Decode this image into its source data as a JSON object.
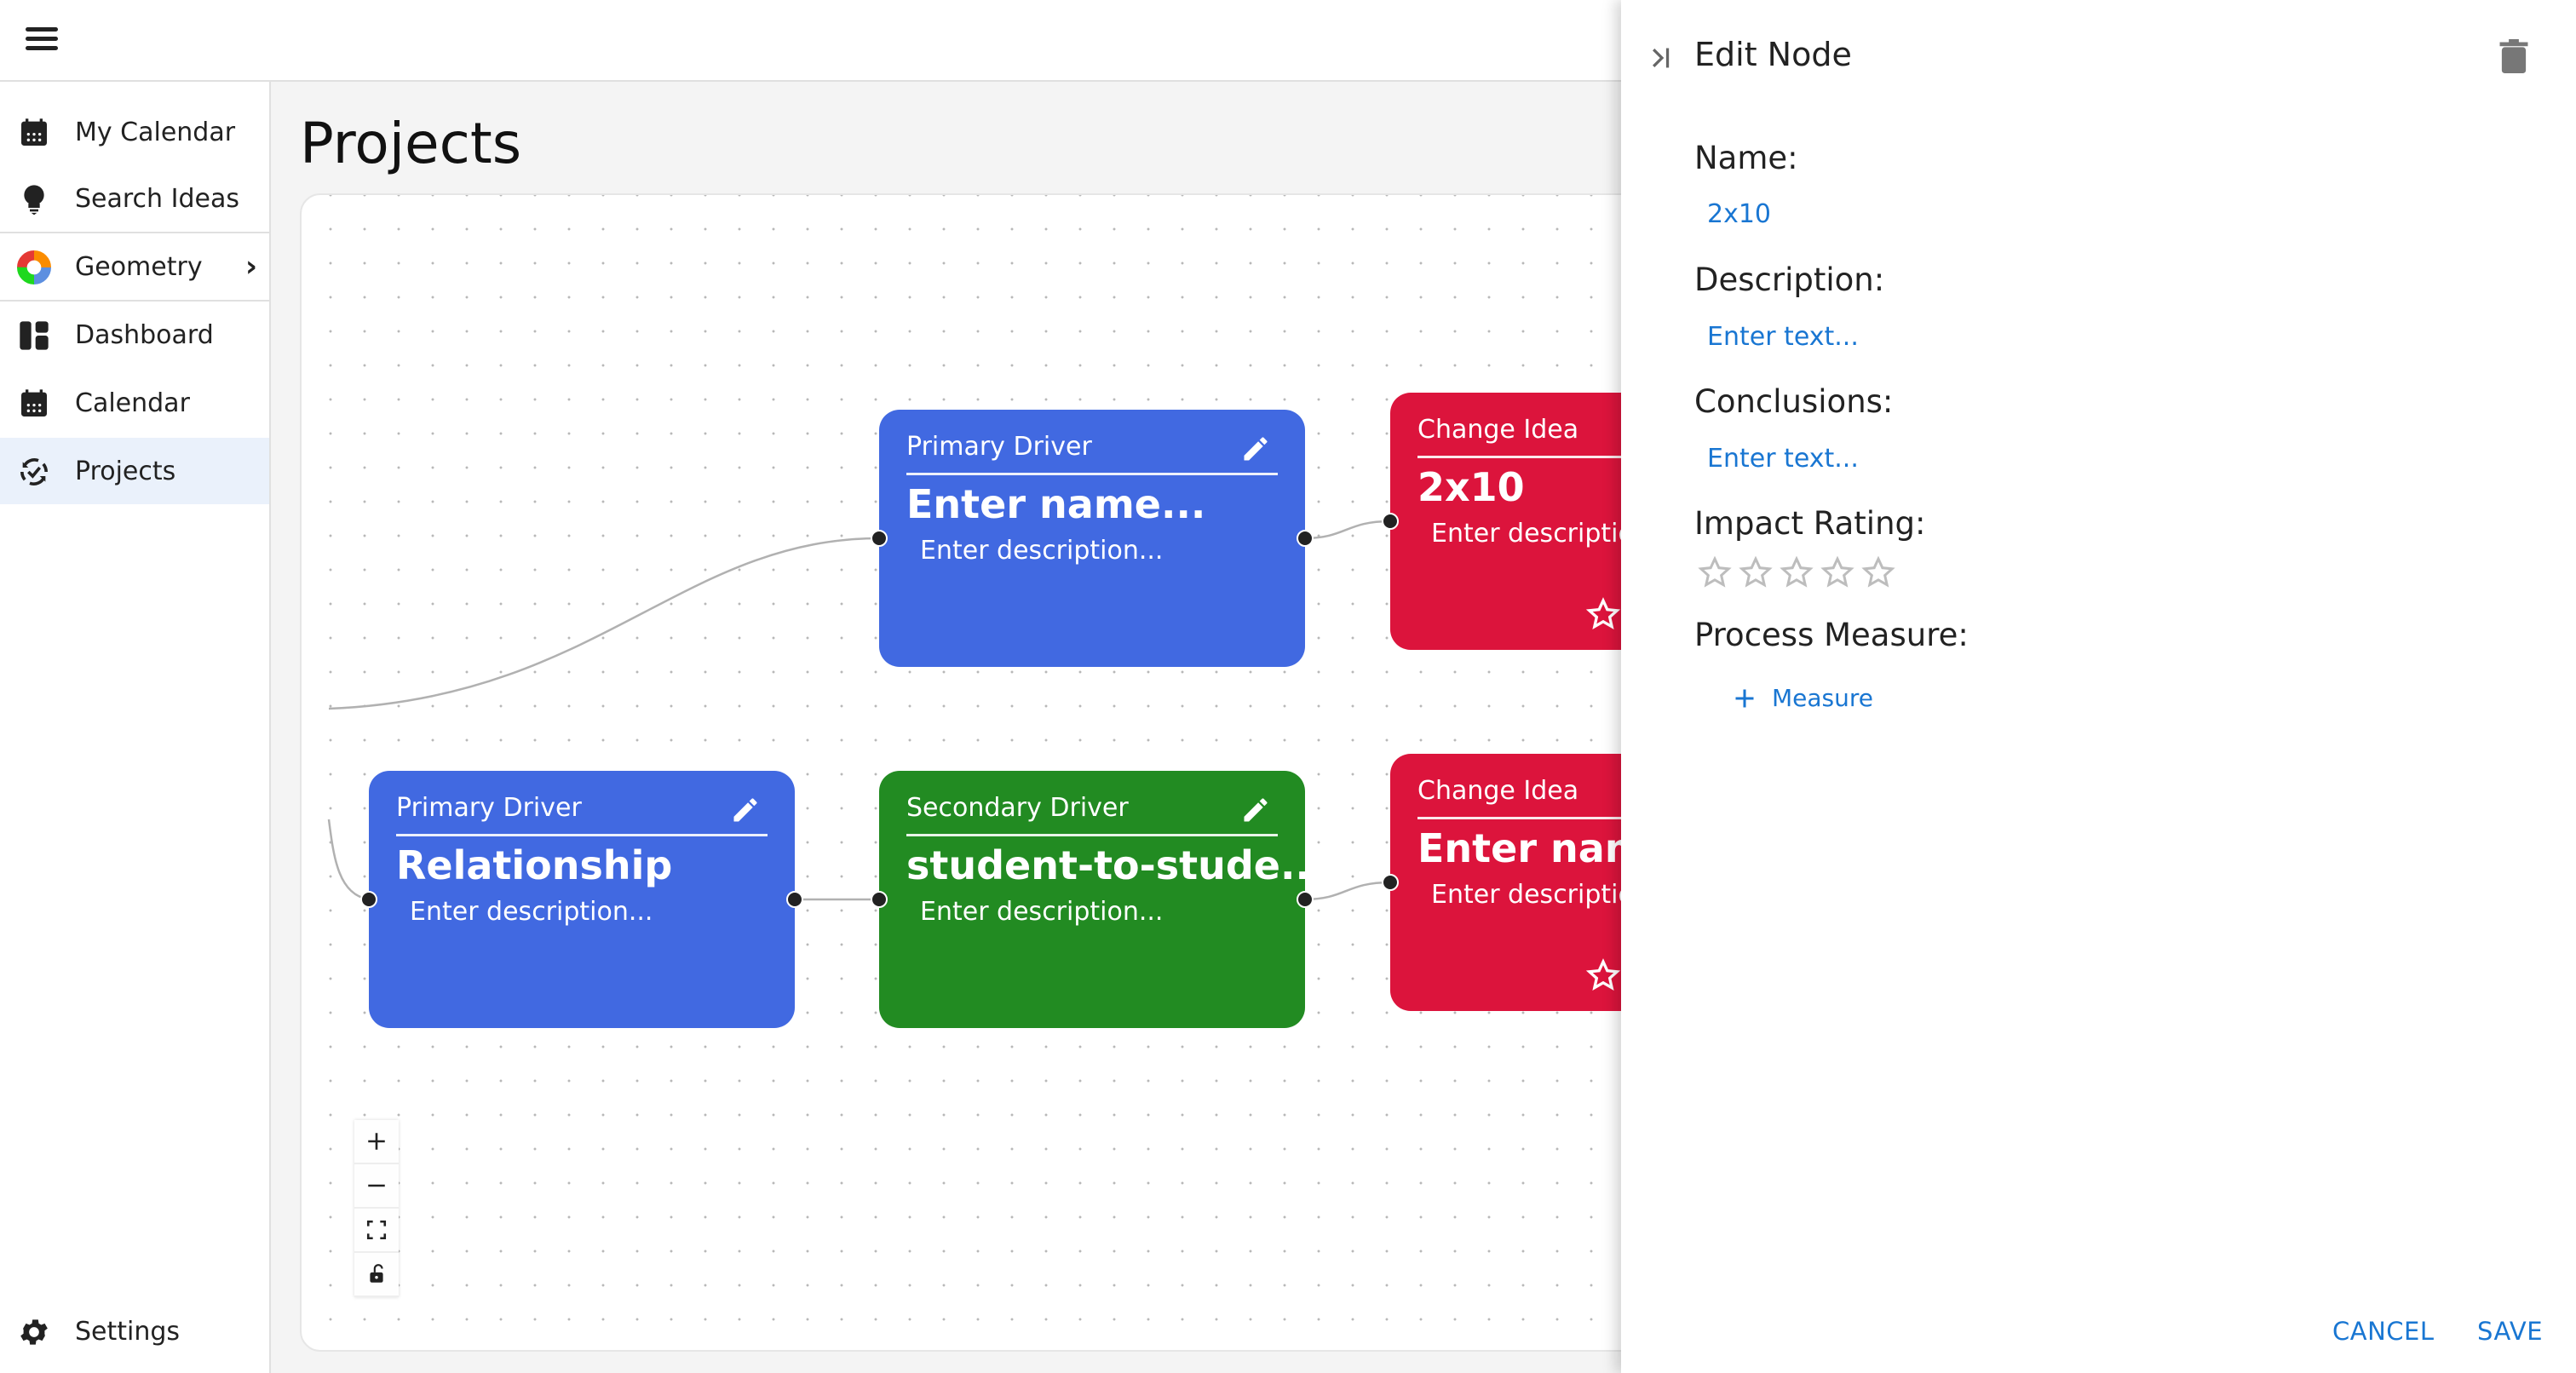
{
  "app": {
    "menu_icon": "hamburger-menu-icon"
  },
  "sidebar": {
    "items": [
      {
        "label": "My Calendar",
        "icon": "calendar-icon"
      },
      {
        "label": "Search Ideas",
        "icon": "lightbulb-icon"
      },
      {
        "label": "Geometry",
        "icon": "colorful-ring-icon",
        "has_chevron": true
      },
      {
        "label": "Dashboard",
        "icon": "dashboard-icon"
      },
      {
        "label": "Calendar",
        "icon": "calendar-icon"
      },
      {
        "label": "Projects",
        "icon": "sync-check-icon",
        "active": true
      }
    ],
    "chevron": "›",
    "settings": {
      "label": "Settings",
      "icon": "gear-icon"
    }
  },
  "page": {
    "title": "Projects"
  },
  "canvas": {
    "nodes": [
      {
        "type": "Primary Driver",
        "name": "Enter name...",
        "description": "Enter description...",
        "color": "#4169e1",
        "icon": "pencil-icon"
      },
      {
        "type": "Change Idea",
        "name": "2x10",
        "description": "Enter description...",
        "color": "#dc143c",
        "icon": "star-outline-icon"
      },
      {
        "type": "Primary Driver",
        "name": "Relationship",
        "description": "Enter description...",
        "color": "#4169e1",
        "icon": "pencil-icon"
      },
      {
        "type": "Secondary Driver",
        "name": "student-to-stude...",
        "description": "Enter description...",
        "color": "#228b22",
        "icon": "pencil-icon"
      },
      {
        "type": "Change Idea",
        "name": "Enter name...",
        "description": "Enter description...",
        "color": "#dc143c",
        "icon": "star-outline-icon"
      }
    ],
    "controls": [
      "zoom-in",
      "zoom-out",
      "fit-view",
      "toggle-lock"
    ]
  },
  "edit_panel": {
    "title": "Edit Node",
    "fields": {
      "name_label": "Name:",
      "name_value": "2x10",
      "description_label": "Description:",
      "description_placeholder": "Enter text...",
      "conclusions_label": "Conclusions:",
      "conclusions_placeholder": "Enter text...",
      "impact_label": "Impact Rating:",
      "impact_rating": 0,
      "impact_max": 5,
      "process_measure_label": "Process Measure:",
      "add_measure_label": "Measure"
    },
    "cancel_label": "CANCEL",
    "save_label": "SAVE",
    "accent_color": "#1976d2"
  }
}
